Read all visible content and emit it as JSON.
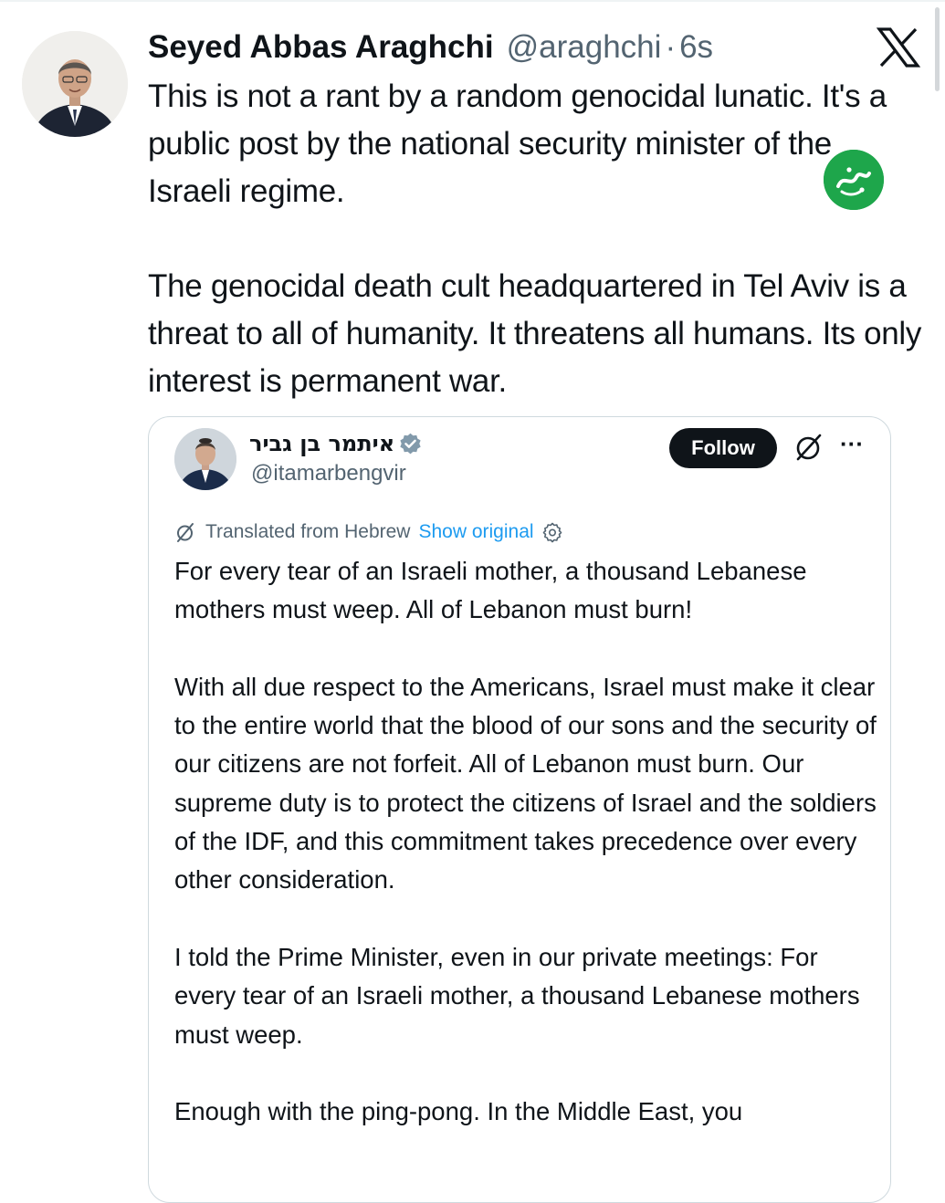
{
  "tweet": {
    "author_name": "Seyed Abbas Araghchi",
    "author_handle": "@araghchi",
    "separator": "·",
    "time_ago": "6s",
    "paragraphs": [
      "This is not a rant by a random genocidal lunatic. It's a public post by the national security minister of the Israeli regime.",
      "The genocidal death cult headquartered in Tel Aviv is a threat to all of humanity. It threatens all humans. Its only interest is permanent war."
    ]
  },
  "icons": {
    "platform_logo": "x-logo-icon",
    "watermark": "green-circle-watermark-logo",
    "verified": "verified-badge-icon",
    "grok": "grok-icon",
    "more": "more-options-icon",
    "translate": "translate-icon",
    "settings": "gear-icon"
  },
  "colors": {
    "text_primary": "#0f1419",
    "text_secondary": "#536471",
    "link_blue": "#1d9bf0",
    "watermark_green": "#1ea64b",
    "border": "#cfd9de"
  },
  "quoted_tweet": {
    "author_name": "איתמר בן גביר",
    "author_handle": "@itamarbengvir",
    "follow_label": "Follow",
    "more_label": "···",
    "translated_label": "Translated from Hebrew",
    "show_original_label": "Show original",
    "paragraphs": [
      "For every tear of an Israeli mother, a thousand Lebanese mothers must weep. All of Lebanon must burn!",
      "With all due respect to the Americans, Israel must make it clear to the entire world that the blood of our sons and the security of our citizens are not forfeit. All of Lebanon must burn. Our supreme duty is to protect the citizens of Israel and the soldiers of the IDF, and this commitment takes precedence over every other consideration.",
      "I told the Prime Minister, even in our private meetings: For every tear of an Israeli mother, a thousand Lebanese mothers must weep.",
      "Enough with the ping-pong. In the Middle East, you"
    ]
  }
}
